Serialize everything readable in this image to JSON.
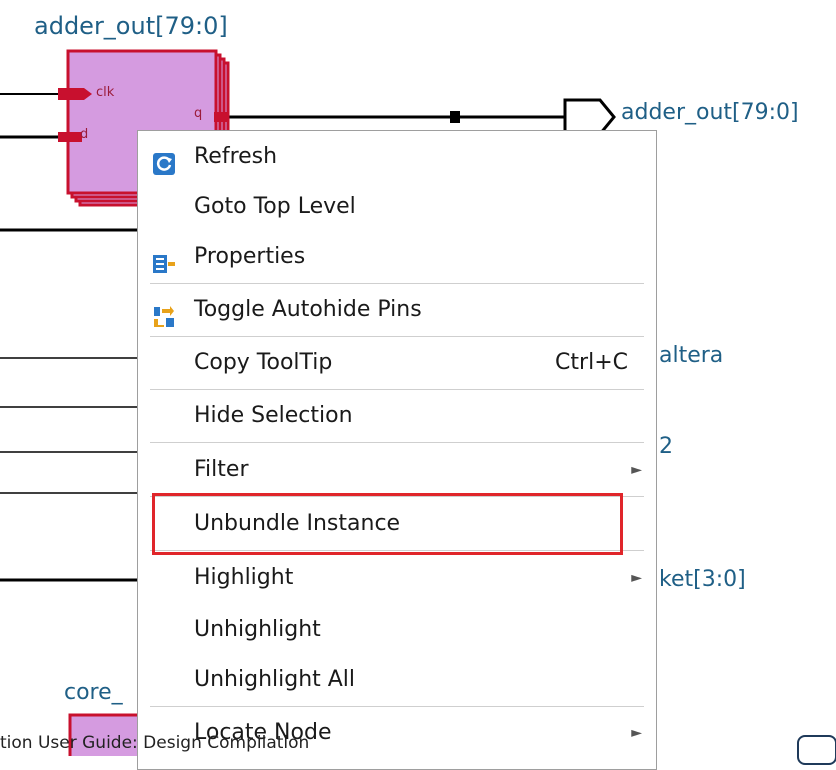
{
  "schematic": {
    "register_title": "adder_out[79:0]",
    "output_port_label": "adder_out[79:0]",
    "pin_clk": "clk",
    "pin_d": "d",
    "pin_q": "q",
    "partial_altera": "altera",
    "partial_two": "2",
    "partial_ket": "ket[3:0]",
    "core_label": "core_"
  },
  "menu": {
    "refresh": "Refresh",
    "goto_top": "Goto Top Level",
    "properties": "Properties",
    "toggle_autohide": "Toggle Autohide Pins",
    "copy_tooltip": "Copy ToolTip",
    "copy_tooltip_shortcut": "Ctrl+C",
    "hide_selection": "Hide Selection",
    "filter": "Filter",
    "unbundle": "Unbundle Instance",
    "highlight": "Highlight",
    "unhighlight": "Unhighlight",
    "unhighlight_all": "Unhighlight All",
    "locate_node": "Locate Node"
  },
  "footer": {
    "text": "tion User Guide: Design Compilation"
  },
  "colors": {
    "register_fill": "#d59be0",
    "register_border": "#c8102e",
    "highlight_box": "#e0252a",
    "label_blue": "#1f5f86"
  }
}
